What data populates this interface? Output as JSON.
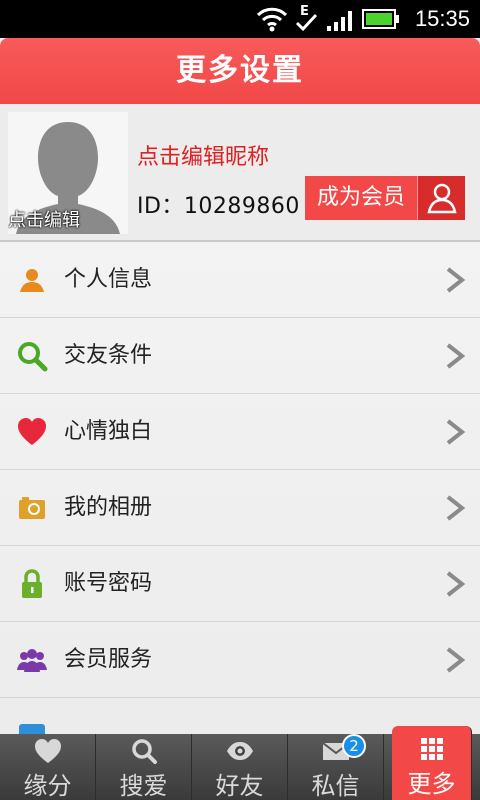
{
  "status_bar": {
    "time": "15:35",
    "icons": [
      "wifi-icon",
      "edge-signal-icon",
      "cell-signal-icon",
      "battery-icon"
    ]
  },
  "header": {
    "title": "更多设置"
  },
  "profile": {
    "avatar_edit_label": "点击编辑",
    "nickname_prompt": "点击编辑昵称",
    "id_text": "ID：10289860",
    "member_button": "成为会员"
  },
  "menu": {
    "items": [
      {
        "label": "个人信息",
        "icon": "person-icon"
      },
      {
        "label": "交友条件",
        "icon": "search-icon"
      },
      {
        "label": "心情独白",
        "icon": "heart-icon"
      },
      {
        "label": "我的相册",
        "icon": "camera-icon"
      },
      {
        "label": "账号密码",
        "icon": "lock-icon"
      },
      {
        "label": "会员服务",
        "icon": "group-icon"
      }
    ]
  },
  "tabs": [
    {
      "label": "缘分",
      "icon": "heart-icon"
    },
    {
      "label": "搜爱",
      "icon": "search-icon"
    },
    {
      "label": "好友",
      "icon": "eye-icon"
    },
    {
      "label": "私信",
      "icon": "mail-icon",
      "badge": "2"
    },
    {
      "label": "更多",
      "icon": "grid-icon",
      "active": true
    }
  ],
  "colors": {
    "accent": "#f24848",
    "badge": "#1a8fe8"
  }
}
